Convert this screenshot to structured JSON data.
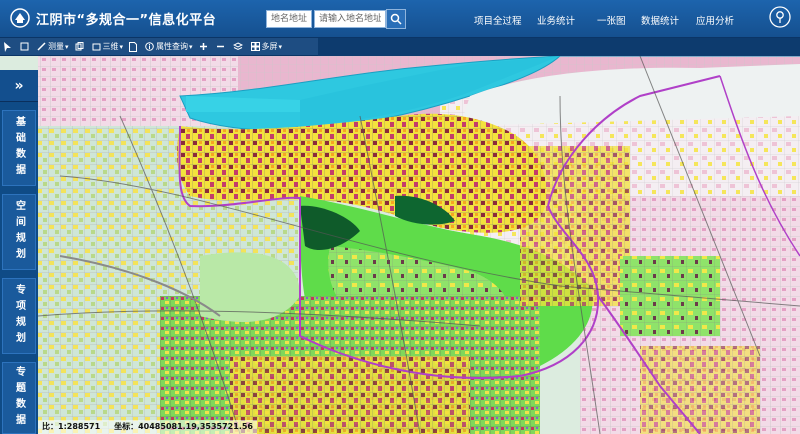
{
  "header": {
    "title": "江阴市“多规合一”信息化平台",
    "search_place_placeholder": "地名地址",
    "search_input_placeholder": "请输入地名地址",
    "nav": [
      "项目全过程",
      "业务统计",
      "一张图",
      "数据统计",
      "应用分析"
    ]
  },
  "toolbar": {
    "measure": "测量",
    "threed": "三维",
    "attribute_query": "属性查询",
    "multiscreen": "多屏"
  },
  "sidebar": {
    "collapse": "»",
    "tabs": [
      "基础数据",
      "空间规划",
      "专项规划",
      "专题数据"
    ]
  },
  "status": {
    "scale_label": "比：",
    "scale_value": "1:288571",
    "coord_label": "坐标：",
    "coord_value": "40485081.19,3535721.56"
  },
  "colors": {
    "header": "#1a5ca1",
    "river": "#2ec8e0",
    "urban_pink": "#e7a3c0",
    "yellow": "#f1e24a",
    "green": "#5fdc4a",
    "purple_boundary": "#b040c8"
  }
}
